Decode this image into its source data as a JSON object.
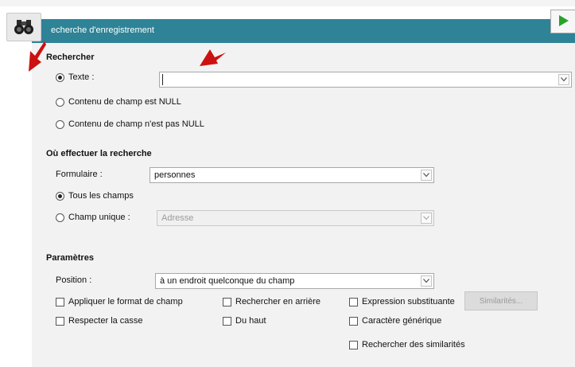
{
  "window": {
    "title": "echerche d'enregistrement"
  },
  "search": {
    "section_title": "Rechercher",
    "text_label": "Texte :",
    "text_value": "",
    "null_label": "Contenu de champ est NULL",
    "not_null_label": "Contenu de champ n'est pas NULL"
  },
  "where": {
    "section_title": "Où effectuer la recherche",
    "form_label": "Formulaire :",
    "form_value": "personnes",
    "all_fields_label": "Tous les champs",
    "single_field_label": "Champ unique :",
    "single_field_value": "Adresse"
  },
  "params": {
    "section_title": "Paramètres",
    "position_label": "Position :",
    "position_value": "à un endroit quelconque du champ",
    "apply_format": "Appliquer le format de champ",
    "search_backwards": "Rechercher en arrière",
    "substitution_expr": "Expression substituante",
    "match_case": "Respecter la casse",
    "from_top": "Du haut",
    "wildcard": "Caractère générique",
    "similarity_search": "Rechercher des similarités",
    "similarities_button": "Similarités..."
  },
  "colors": {
    "titlebar": "#2e8396",
    "annotation_arrow": "#cc1111",
    "run_icon": "#2aa12a"
  },
  "icons": {
    "toolbar": "binoculars-icon",
    "run": "run-triangle-icon",
    "dropdown": "chevron-down-icon"
  }
}
